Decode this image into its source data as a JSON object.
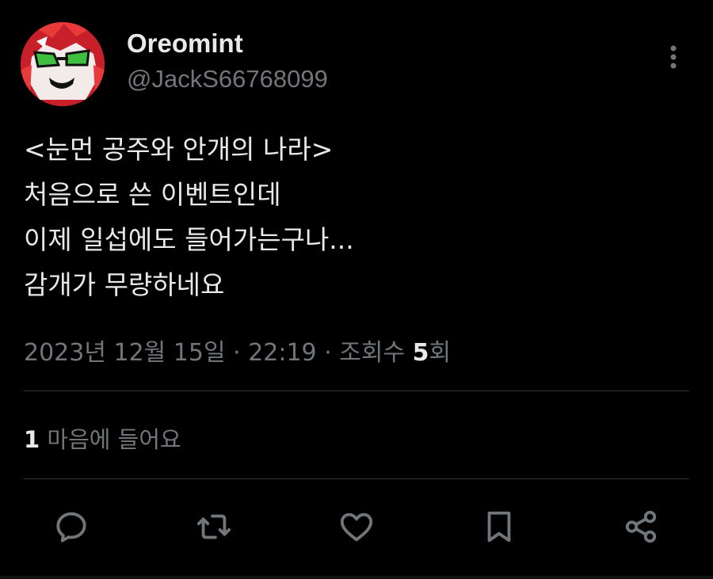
{
  "tweet": {
    "display_name": "Oreomint",
    "handle": "@JackS66768099",
    "text_lines": [
      "<눈먼 공주와 안개의 나라>",
      "처음으로 쓴 이벤트인데",
      "이제 일섭에도 들어가는구나...",
      "감개가 무량하네요"
    ],
    "meta": {
      "date": "2023년 12월 15일",
      "sep1": " · ",
      "time": "22:19",
      "sep2": " · ",
      "views_label": "조회수 ",
      "views_count": "5",
      "views_suffix": "회"
    },
    "likes": {
      "count": "1",
      "label": " 마음에 들어요"
    }
  },
  "actions": [
    {
      "name": "reply-icon"
    },
    {
      "name": "retweet-icon"
    },
    {
      "name": "like-icon"
    },
    {
      "name": "bookmark-icon"
    },
    {
      "name": "share-icon"
    }
  ],
  "colors": {
    "background": "#000000",
    "primary_text": "#e7e9ea",
    "secondary_text": "#71767b",
    "divider": "#2f3336",
    "avatar_red": "#c8202a",
    "glasses_green": "#3fbf3f"
  }
}
